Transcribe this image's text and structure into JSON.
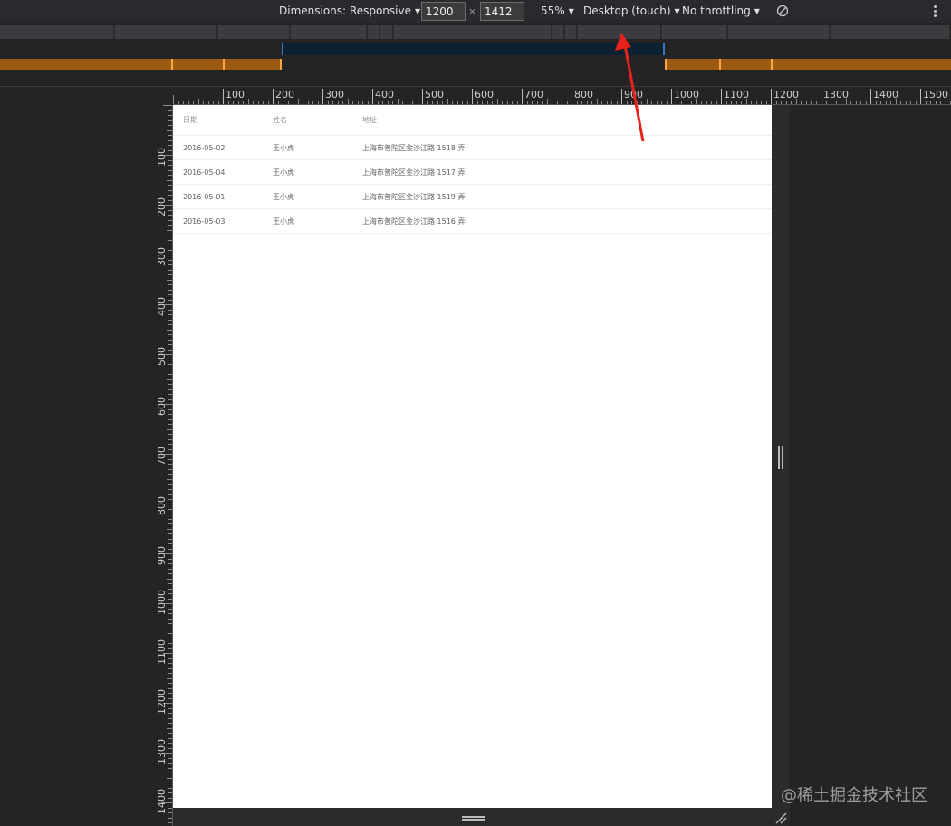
{
  "toolbar": {
    "dimensions_label": "Dimensions: Responsive",
    "width_value": "1200",
    "times": "×",
    "height_value": "1412",
    "zoom": "55%",
    "device_type": "Desktop (touch)",
    "throttling": "No throttling",
    "caret": "▼"
  },
  "ruler_top": [
    "100",
    "200",
    "300",
    "400",
    "500",
    "600",
    "700",
    "800",
    "900",
    "1000",
    "1100",
    "1200",
    "1300",
    "1400",
    "1500"
  ],
  "ruler_left": [
    "100",
    "200",
    "300",
    "400",
    "500",
    "600",
    "700",
    "800",
    "900",
    "1000",
    "1100",
    "1200",
    "1300",
    "1400"
  ],
  "table": {
    "headers": [
      "日期",
      "姓名",
      "地址"
    ],
    "rows": [
      [
        "2016-05-02",
        "王小虎",
        "上海市普陀区金沙江路 1518 弄"
      ],
      [
        "2016-05-04",
        "王小虎",
        "上海市普陀区金沙江路 1517 弄"
      ],
      [
        "2016-05-01",
        "王小虎",
        "上海市普陀区金沙江路 1519 弄"
      ],
      [
        "2016-05-03",
        "王小虎",
        "上海市普陀区金沙江路 1516 弄"
      ]
    ]
  },
  "watermark": "@稀土掘金技术社区",
  "colors": {
    "arrow": "#e8221a",
    "accent_blue": "#3a76c4",
    "media_orange": "#9c5a12"
  }
}
